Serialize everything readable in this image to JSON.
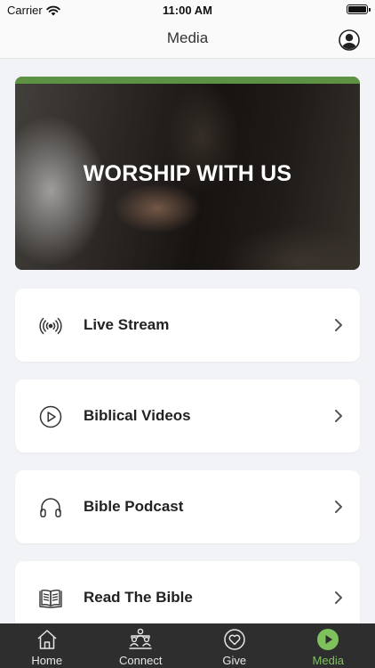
{
  "status_bar": {
    "carrier": "Carrier",
    "time": "11:00 AM"
  },
  "nav": {
    "title": "Media"
  },
  "hero": {
    "heading": "WORSHIP WITH US"
  },
  "menu": [
    {
      "label": "Live Stream",
      "icon": "broadcast-icon"
    },
    {
      "label": "Biblical Videos",
      "icon": "play-circle-icon"
    },
    {
      "label": "Bible Podcast",
      "icon": "headphones-icon"
    },
    {
      "label": "Read The Bible",
      "icon": "book-icon"
    }
  ],
  "tabs": [
    {
      "label": "Home",
      "icon": "home-icon",
      "active": false
    },
    {
      "label": "Connect",
      "icon": "people-icon",
      "active": false
    },
    {
      "label": "Give",
      "icon": "heart-circle-icon",
      "active": false
    },
    {
      "label": "Media",
      "icon": "play-icon",
      "active": true
    }
  ],
  "colors": {
    "accent": "#7dc25a",
    "tab_bar": "#2e2e2e",
    "background": "#f2f3f6"
  }
}
